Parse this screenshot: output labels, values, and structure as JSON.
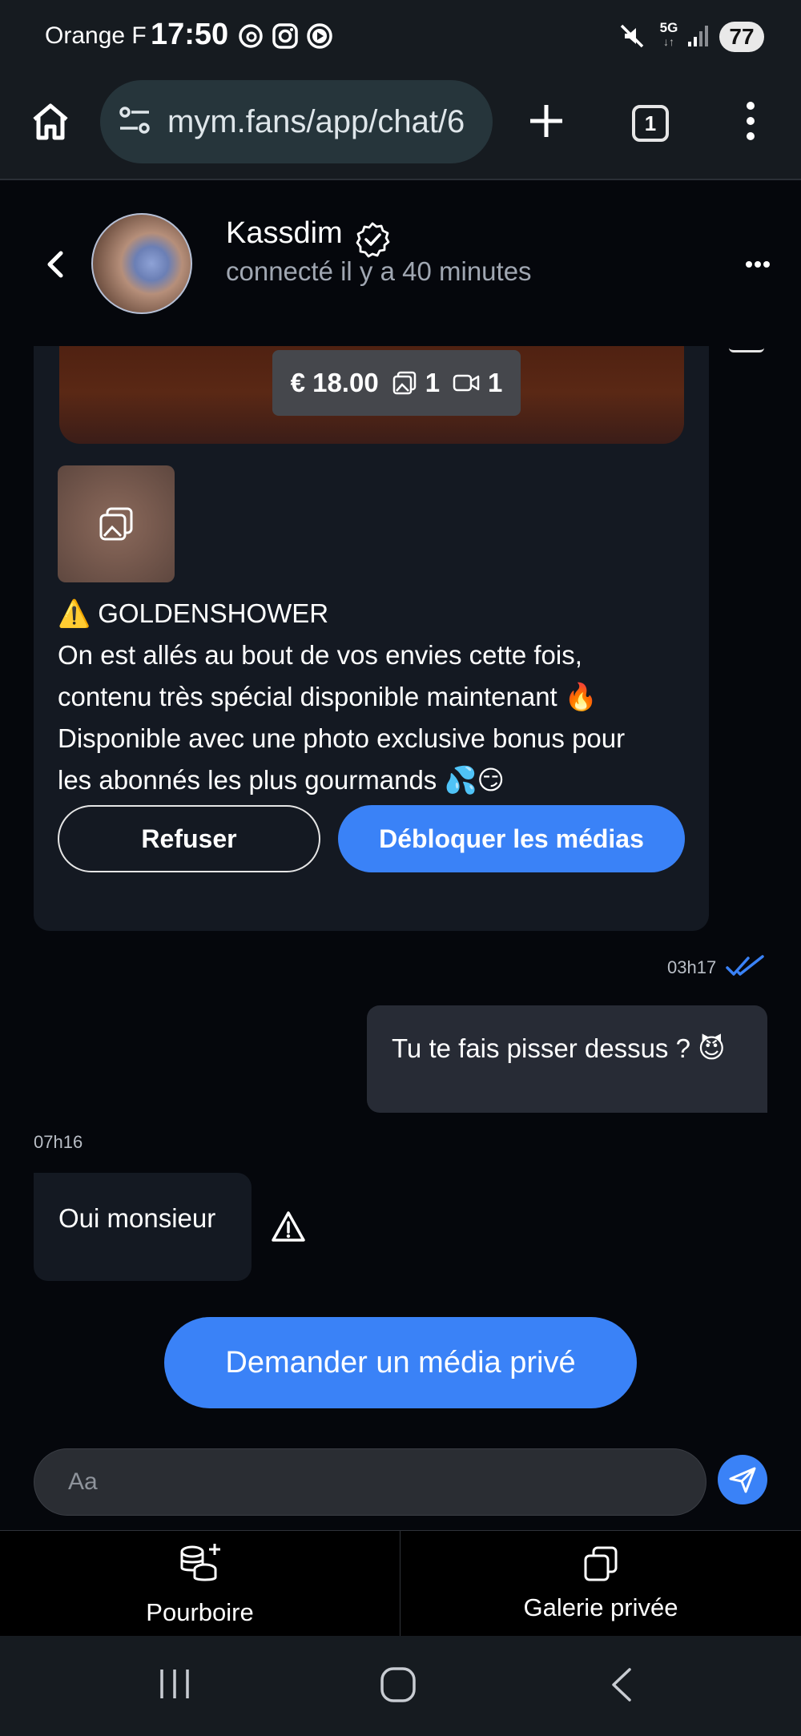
{
  "status_bar": {
    "carrier": "Orange F",
    "time": "17:50",
    "network": "5G",
    "battery": "77"
  },
  "browser": {
    "url": "mym.fans/app/chat/6",
    "tab_count": "1"
  },
  "chat_header": {
    "contact_name": "Kassdim",
    "status": "connecté il y a 40 minutes"
  },
  "offer": {
    "price": "€ 18.00",
    "photo_count": "1",
    "video_count": "1",
    "lines": [
      "⚠️ GOLDENSHOWER",
      "On est allés au bout de vos envies cette fois,",
      "contenu très spécial disponible maintenant 🔥",
      "Disponible avec une photo exclusive bonus pour",
      "les abonnés les plus gourmands 💦😏"
    ],
    "refuse_label": "Refuser",
    "unlock_label": "Débloquer les médias"
  },
  "messages": {
    "out_time": "03h17",
    "out_text": "Tu te fais pisser dessus ? 😈",
    "in_time": "07h16",
    "in_text": "Oui monsieur"
  },
  "request_label": "Demander un média privé",
  "composer": {
    "placeholder": "Aa"
  },
  "bottom_actions": {
    "tip_label": "Pourboire",
    "gallery_label": "Galerie privée"
  },
  "colors": {
    "accent": "#3a82f7",
    "background": "#05070c",
    "bubble_in": "#141922",
    "bubble_out": "#272b35"
  }
}
